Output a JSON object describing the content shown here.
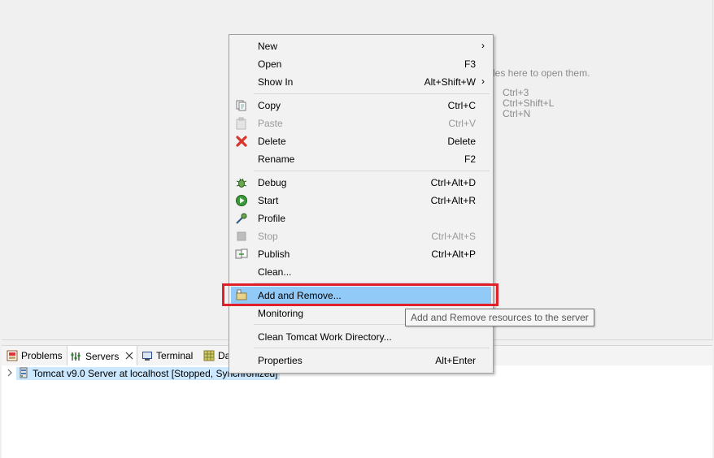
{
  "editor": {
    "drop_hint": "les here to open them.",
    "shortcuts": [
      "Ctrl+3",
      "Ctrl+Shift+L",
      "Ctrl+N"
    ]
  },
  "tabs": [
    {
      "label": "Problems",
      "icon": "problems-icon"
    },
    {
      "label": "Servers",
      "icon": "servers-icon"
    },
    {
      "label": "Terminal",
      "icon": "terminal-icon"
    },
    {
      "label": "Da",
      "icon": "data-source-icon"
    }
  ],
  "servers": {
    "row_label": "Tomcat v9.0 Server at localhost  [Stopped, Synchronized]"
  },
  "menu": {
    "items": [
      {
        "label": "New",
        "accel": "",
        "submenu": true
      },
      {
        "label": "Open",
        "accel": "F3"
      },
      {
        "label": "Show In",
        "accel": "Alt+Shift+W",
        "submenu": true
      },
      {
        "label": "Copy",
        "accel": "Ctrl+C",
        "icon": "copy-icon"
      },
      {
        "label": "Paste",
        "accel": "Ctrl+V",
        "icon": "paste-icon",
        "disabled": true
      },
      {
        "label": "Delete",
        "accel": "Delete",
        "icon": "delete-icon"
      },
      {
        "label": "Rename",
        "accel": "F2"
      },
      {
        "label": "Debug",
        "accel": "Ctrl+Alt+D",
        "icon": "debug-icon"
      },
      {
        "label": "Start",
        "accel": "Ctrl+Alt+R",
        "icon": "start-icon"
      },
      {
        "label": "Profile",
        "accel": "",
        "icon": "profile-icon"
      },
      {
        "label": "Stop",
        "accel": "Ctrl+Alt+S",
        "icon": "stop-icon",
        "disabled": true
      },
      {
        "label": "Publish",
        "accel": "Ctrl+Alt+P",
        "icon": "publish-icon"
      },
      {
        "label": "Clean...",
        "accel": ""
      },
      {
        "label": "Add and Remove...",
        "accel": "",
        "icon": "add-remove-icon",
        "highlighted": true
      },
      {
        "label": "Monitoring",
        "accel": ""
      },
      {
        "label": "Clean Tomcat Work Directory...",
        "accel": ""
      },
      {
        "label": "Properties",
        "accel": "Alt+Enter"
      }
    ],
    "submenu_arrow": "›"
  },
  "tooltip": "Add and Remove resources to the server",
  "colors": {
    "highlight": "#91c9f7",
    "annotation_box": "#e0202a",
    "selection": "#cce8ff"
  }
}
